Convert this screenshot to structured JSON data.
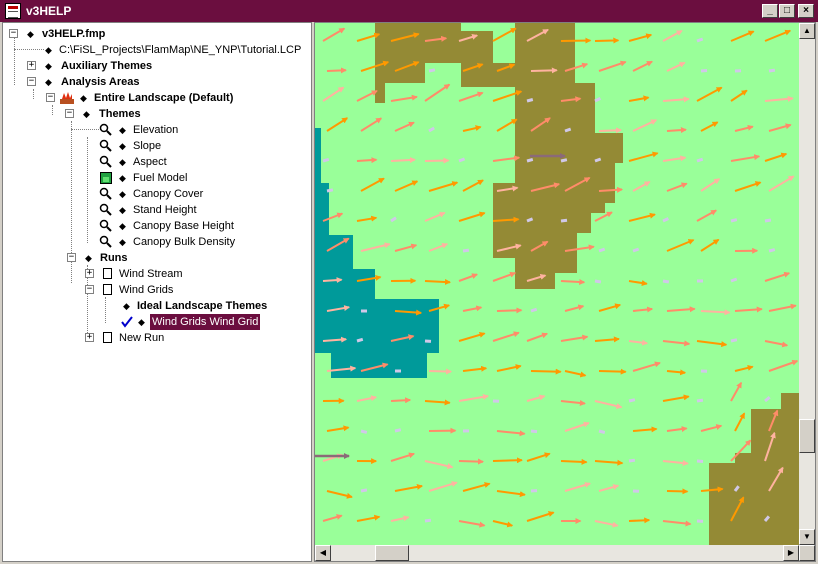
{
  "window": {
    "title": "v3HELP",
    "controls": {
      "minimize": "_",
      "maximize": "□",
      "close": "×"
    }
  },
  "tree": {
    "root": "v3HELP.fmp",
    "landscape_path": "C:\\FiSL_Projects\\FlamMap\\NE_YNP\\Tutorial.LCP",
    "auxiliary_themes": "Auxiliary Themes",
    "analysis_areas": "Analysis Areas",
    "entire_landscape": "Entire Landscape (Default)",
    "themes": "Themes",
    "theme_items": [
      "Elevation",
      "Slope",
      "Aspect",
      "Fuel Model",
      "Canopy Cover",
      "Stand Height",
      "Canopy Base Height",
      "Canopy Bulk Density"
    ],
    "runs": "Runs",
    "wind_stream": "Wind Stream",
    "wind_grids": "Wind Grids",
    "ideal_landscape_themes": "Ideal Landscape Themes",
    "wind_grid_selected": "Wind Grids Wind Grid",
    "new_run": "New Run"
  },
  "map": {
    "colors": {
      "grass": "#99ff99",
      "olive": "#948a35",
      "teal": "#009a9a",
      "arrow_orange": "#ff9900",
      "arrow_salmon": "#ff8c69",
      "arrow_pink": "#ffb3a0",
      "arrow_lilac": "#d0c8e8",
      "arrow_purple": "#8b6a78"
    }
  }
}
